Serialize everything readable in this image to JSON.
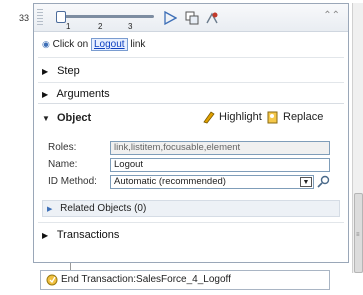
{
  "step": {
    "number": "33"
  },
  "toolbar": {
    "ticks": [
      "1",
      "2",
      "3"
    ],
    "play_icon": "play-icon",
    "copy_icon": "copy-icon",
    "record_icon": "record-icon",
    "collapse_icon": "double-chevron-up-icon"
  },
  "header": {
    "prefix": "Click on",
    "link_text": "Logout",
    "suffix": "link"
  },
  "sections": {
    "step": "Step",
    "arguments": "Arguments",
    "object": "Object",
    "transactions": "Transactions"
  },
  "object": {
    "highlight_label": "Highlight",
    "replace_label": "Replace",
    "roles_label": "Roles:",
    "roles_value": "link,listitem,focusable,element",
    "name_label": "Name:",
    "name_value": "Logout",
    "id_method_label": "ID Method:",
    "id_method_value": "Automatic (recommended)",
    "related_objects": "Related Objects (0)"
  },
  "end_step": {
    "label": "End Transaction:SalesForce_4_Logoff"
  },
  "colors": {
    "accent": "#3d6fb7",
    "link": "#0d3fbf",
    "panel_border": "#9aa7b8"
  }
}
